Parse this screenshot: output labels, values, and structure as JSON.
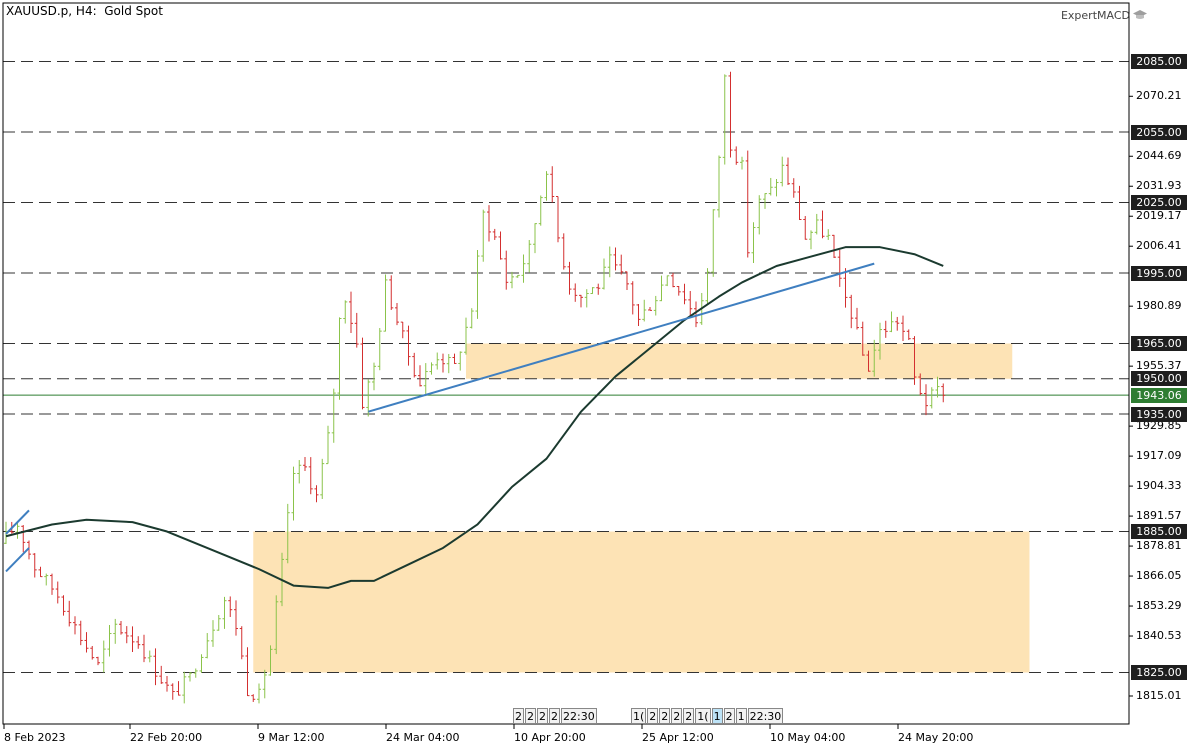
{
  "header": {
    "symbol": "XAUUSD.p",
    "timeframe": "H4",
    "description": "Gold Spot",
    "indicator": "ExpertMACD"
  },
  "colors": {
    "bull": "#8bc34a",
    "bear": "#d32f2f",
    "ma": "#1b3a2f",
    "trendline": "#3f7fc0",
    "zone": "#fde3b5",
    "level_line": "#333333",
    "current_line": "#2e7d32"
  },
  "icons": [
    "graduation-cap-icon"
  ],
  "period_separators": [
    {
      "label": "2"
    },
    {
      "label": "2"
    },
    {
      "label": "2"
    },
    {
      "label": "2"
    },
    {
      "label": "22:30"
    },
    {
      "label": "1("
    },
    {
      "label": "2"
    },
    {
      "label": "2"
    },
    {
      "label": "2"
    },
    {
      "label": "2"
    },
    {
      "label": "1("
    },
    {
      "label": "1",
      "active": true
    },
    {
      "label": "2"
    },
    {
      "label": "1"
    },
    {
      "label": "22:30"
    }
  ],
  "chart_data": {
    "type": "candlestick",
    "title": "XAUUSD.p, H4:  Gold Spot",
    "xlabel": "",
    "ylabel": "",
    "ylim": [
      1807,
      2089
    ],
    "grid": false,
    "price_ticks": [
      "2070.21",
      "2044.69",
      "2031.93",
      "2019.17",
      "2006.41",
      "1980.89",
      "1955.37",
      "1929.85",
      "1917.09",
      "1904.33",
      "1891.57",
      "1878.81",
      "1866.05",
      "1853.29",
      "1840.53",
      "1815.01"
    ],
    "time_ticks": [
      "8 Feb 2023",
      "22 Feb 20:00",
      "9 Mar 12:00",
      "24 Mar 04:00",
      "10 Apr 20:00",
      "25 Apr 12:00",
      "10 May 04:00",
      "24 May 20:00"
    ],
    "levels": [
      "2085.00",
      "2055.00",
      "2025.00",
      "1995.00",
      "1965.00",
      "1950.00",
      "1935.00",
      "1885.00",
      "1825.00"
    ],
    "current_price": "1943.06",
    "zones": [
      {
        "from": "1950.00",
        "to": "1965.00",
        "start_bar": 80,
        "end_bar": 175
      },
      {
        "from": "1825.00",
        "to": "1885.00",
        "start_bar": 43,
        "end_bar": 178
      }
    ],
    "trendlines": [
      {
        "bar1": 63,
        "price1": 1936,
        "bar2": 151,
        "price2": 1999
      },
      {
        "bar1": 0,
        "price1": 1884,
        "bar2": 4,
        "price2": 1894
      },
      {
        "bar1": 0,
        "price1": 1868,
        "bar2": 4,
        "price2": 1878
      }
    ],
    "moving_average": [
      [
        0,
        1883
      ],
      [
        8,
        1888
      ],
      [
        14,
        1890
      ],
      [
        22,
        1889
      ],
      [
        28,
        1885
      ],
      [
        36,
        1877
      ],
      [
        44,
        1869
      ],
      [
        50,
        1862
      ],
      [
        56,
        1861
      ],
      [
        60,
        1864
      ],
      [
        64,
        1864
      ],
      [
        70,
        1871
      ],
      [
        76,
        1878
      ],
      [
        82,
        1888
      ],
      [
        88,
        1904
      ],
      [
        94,
        1916
      ],
      [
        100,
        1936
      ],
      [
        106,
        1951
      ],
      [
        112,
        1963
      ],
      [
        118,
        1975
      ],
      [
        124,
        1985
      ],
      [
        128,
        1991
      ],
      [
        134,
        1998
      ],
      [
        140,
        2002
      ],
      [
        146,
        2006
      ],
      [
        152,
        2006
      ],
      [
        158,
        2003
      ],
      [
        163,
        1998
      ]
    ],
    "price_path": [
      [
        0,
        1880
      ],
      [
        3,
        1888
      ],
      [
        6,
        1870
      ],
      [
        10,
        1858
      ],
      [
        14,
        1840
      ],
      [
        17,
        1828
      ],
      [
        20,
        1845
      ],
      [
        24,
        1838
      ],
      [
        27,
        1826
      ],
      [
        30,
        1815
      ],
      [
        33,
        1823
      ],
      [
        36,
        1840
      ],
      [
        39,
        1856
      ],
      [
        41,
        1845
      ],
      [
        43,
        1818
      ],
      [
        45,
        1815
      ],
      [
        47,
        1835
      ],
      [
        49,
        1871
      ],
      [
        51,
        1910
      ],
      [
        53,
        1912
      ],
      [
        55,
        1900
      ],
      [
        57,
        1925
      ],
      [
        58,
        1945
      ],
      [
        59,
        1975
      ],
      [
        60,
        1985
      ],
      [
        62,
        1965
      ],
      [
        63,
        1940
      ],
      [
        65,
        1955
      ],
      [
        67,
        1990
      ],
      [
        69,
        1975
      ],
      [
        71,
        1960
      ],
      [
        73,
        1948
      ],
      [
        76,
        1960
      ],
      [
        79,
        1955
      ],
      [
        82,
        1980
      ],
      [
        84,
        2020
      ],
      [
        86,
        2010
      ],
      [
        88,
        1992
      ],
      [
        90,
        1995
      ],
      [
        92,
        2005
      ],
      [
        95,
        2040
      ],
      [
        97,
        2010
      ],
      [
        99,
        1990
      ],
      [
        101,
        1985
      ],
      [
        104,
        1990
      ],
      [
        106,
        2000
      ],
      [
        109,
        1990
      ],
      [
        111,
        1975
      ],
      [
        114,
        1985
      ],
      [
        116,
        1995
      ],
      [
        119,
        1985
      ],
      [
        121,
        1975
      ],
      [
        123,
        1995
      ],
      [
        125,
        2045
      ],
      [
        126,
        2078
      ],
      [
        127,
        2050
      ],
      [
        129,
        2040
      ],
      [
        130,
        2005
      ],
      [
        132,
        2025
      ],
      [
        134,
        2030
      ],
      [
        136,
        2040
      ],
      [
        138,
        2028
      ],
      [
        140,
        2010
      ],
      [
        142,
        2015
      ],
      [
        144,
        2010
      ],
      [
        146,
        1990
      ],
      [
        148,
        1978
      ],
      [
        150,
        1960
      ],
      [
        151,
        1955
      ],
      [
        153,
        1970
      ],
      [
        156,
        1975
      ],
      [
        158,
        1965
      ],
      [
        159,
        1950
      ],
      [
        161,
        1940
      ],
      [
        163,
        1945
      ]
    ]
  }
}
